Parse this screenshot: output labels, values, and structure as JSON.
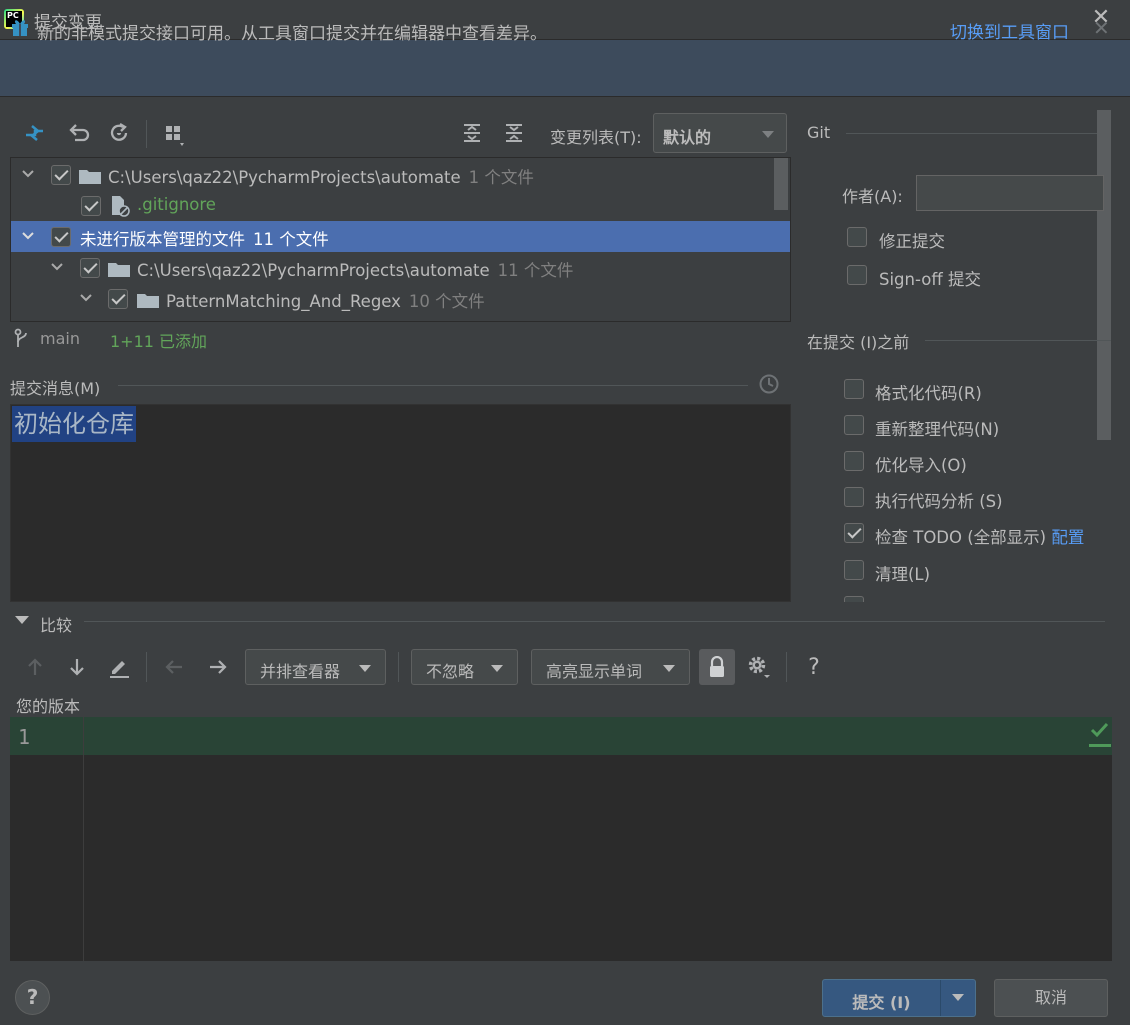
{
  "window": {
    "app_icon_text": "PC",
    "title": "提交变更",
    "close": "✕"
  },
  "banner": {
    "text": "新的非模式提交接口可用。从工具窗口提交并在编辑器中查看差异。",
    "link": "切换到工具窗口",
    "close": "✕"
  },
  "toolbar": {
    "changelist_label": "变更列表(T):",
    "changelist_value": "默认的"
  },
  "tree": {
    "rows": [
      {
        "label": "C:\\Users\\qaz22\\PycharmProjects\\automate",
        "count": "1 个文件"
      },
      {
        "label": ".gitignore",
        "count": ""
      },
      {
        "label": "未进行版本管理的文件",
        "count": "11 个文件"
      },
      {
        "label": "C:\\Users\\qaz22\\PycharmProjects\\automate",
        "count": "11 个文件"
      },
      {
        "label": "PatternMatching_And_Regex",
        "count": "10 个文件"
      }
    ]
  },
  "branch": {
    "name": "main",
    "status": "1+11 已添加"
  },
  "commit_message": {
    "label": "提交消息(M)",
    "value": "初始化仓库"
  },
  "right_panel": {
    "git_label": "Git",
    "author_label": "作者(A):",
    "author_value": "",
    "amend_label": "修正提交",
    "signoff_label": "Sign-off 提交",
    "before_label": "在提交 (I)之前",
    "options": [
      {
        "label": "格式化代码(R)",
        "checked": false
      },
      {
        "label": "重新整理代码(N)",
        "checked": false
      },
      {
        "label": "优化导入(O)",
        "checked": false
      },
      {
        "label": "执行代码分析 (S)",
        "checked": false
      },
      {
        "label": "检查 TODO (全部显示)",
        "checked": true,
        "link": "配置"
      },
      {
        "label": "清理(L)",
        "checked": false
      }
    ]
  },
  "compare": {
    "label": "比较",
    "viewer": "并排查看器",
    "ignore": "不忽略",
    "highlight": "高亮显示单词",
    "help": "?",
    "your_version": "您的版本",
    "line_number": "1"
  },
  "footer": {
    "help": "?",
    "commit": "提交 (I)",
    "cancel": "取消"
  },
  "colors": {
    "background": "#3c3f41",
    "selection": "#4b6eaf",
    "link": "#589df6",
    "added": "#62a55a",
    "commit_button": "#365880",
    "diff_added_line": "#294436"
  }
}
